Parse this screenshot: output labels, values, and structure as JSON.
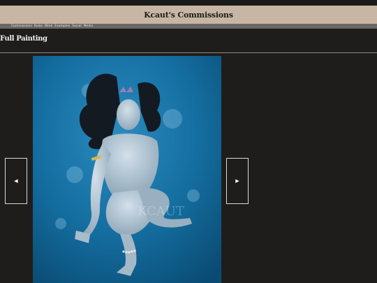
{
  "header": {
    "title": "Kcaut's Commissions"
  },
  "nav": {
    "items": [
      "Commissions",
      "Rules",
      "Work",
      "Examples",
      "Social",
      "Media"
    ]
  },
  "section": {
    "title": "Full Painting"
  },
  "gallery": {
    "prev_symbol": "◀",
    "next_symbol": "▶",
    "watermark": "KCAUT"
  },
  "colors": {
    "header_bg": "#c8b6a4",
    "nav_bg": "#6a6765",
    "page_bg": "#1e1d1b",
    "painting_blue": "#0e5a86"
  }
}
